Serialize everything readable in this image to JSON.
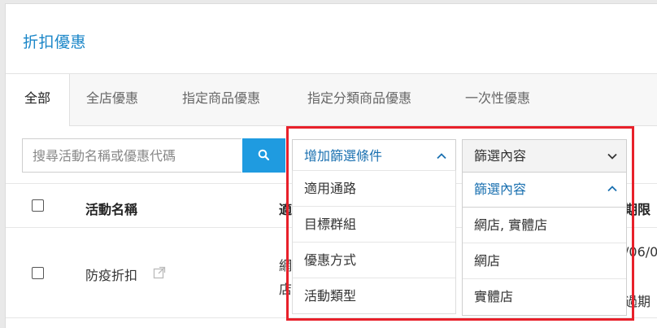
{
  "page_title": "折扣優惠",
  "tabs": [
    {
      "label": "全部",
      "active": true
    },
    {
      "label": "全店優惠"
    },
    {
      "label": "指定商品優惠"
    },
    {
      "label": "指定分類商品優惠"
    },
    {
      "label": "一次性優惠"
    }
  ],
  "search": {
    "placeholder": "搜尋活動名稱或優惠代碼",
    "value": "",
    "button_icon": "search-icon"
  },
  "filter": {
    "add_label": "增加篩選條件",
    "add_options": [
      "適用通路",
      "目標群組",
      "優惠方式",
      "活動類型"
    ],
    "content_label": "篩選內容",
    "content_sub_label": "篩選內容",
    "content_options": [
      "網店, 實體店",
      "網店",
      "實體店"
    ]
  },
  "table": {
    "headers": {
      "name": "活動名稱",
      "col2_partial": "適",
      "col3_partial": "期限"
    },
    "rows": [
      {
        "name": "防疫折扣",
        "col2_partial_1": "網",
        "col2_partial_2": "店",
        "col3_partial_1": "/06/0",
        "col3_partial_2": "過期"
      }
    ]
  },
  "colors": {
    "accent": "#1f9be0",
    "highlight": "#e8202a",
    "link": "#1a70b0"
  }
}
